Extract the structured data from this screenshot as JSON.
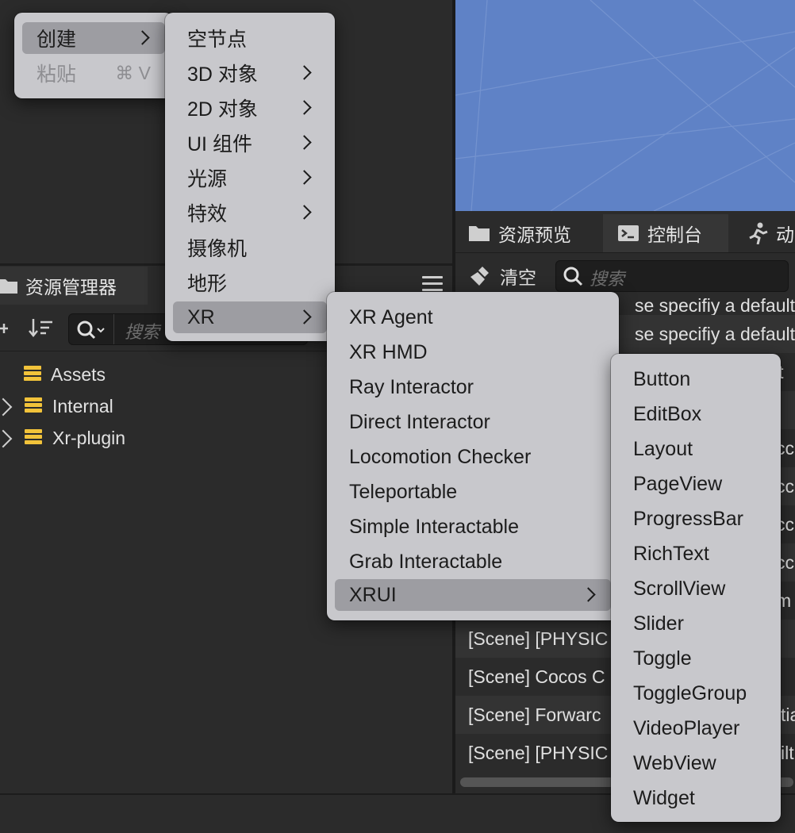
{
  "assets_panel": {
    "tab_label": "资源管理器",
    "search_placeholder": "搜索",
    "tree": [
      {
        "label": "Assets"
      },
      {
        "label": "Internal"
      },
      {
        "label": "Xr-plugin"
      }
    ]
  },
  "console_panel": {
    "tabs": [
      {
        "label": "资源预览"
      },
      {
        "label": "控制台"
      },
      {
        "label": "动"
      }
    ],
    "clear_label": "清空",
    "search_placeholder": "搜索",
    "logs": [
      "se specifiy a default",
      "se specifiy a default",
      "lt",
      "l",
      "cc",
      "cc",
      "cc",
      "cc",
      "m",
      "[Scene] [PHYSIC",
      "[Scene] Cocos C",
      "[Scene] Forwarc",
      "[Scene] [PHYSIC"
    ],
    "logs_right": [
      "",
      "",
      "",
      "",
      "",
      "",
      "",
      "",
      "",
      "",
      "",
      "tia",
      "ilt"
    ]
  },
  "context_menu": {
    "items": [
      {
        "label": "创建",
        "submenu": true,
        "highlighted": true
      },
      {
        "label": "粘贴",
        "shortcut": "⌘ V",
        "disabled": true
      }
    ]
  },
  "create_menu": {
    "items": [
      {
        "label": "空节点",
        "submenu": false
      },
      {
        "label": "3D 对象",
        "submenu": true
      },
      {
        "label": "2D 对象",
        "submenu": true
      },
      {
        "label": "UI 组件",
        "submenu": true
      },
      {
        "label": "光源",
        "submenu": true
      },
      {
        "label": "特效",
        "submenu": true
      },
      {
        "label": "摄像机",
        "submenu": false
      },
      {
        "label": "地形",
        "submenu": false
      },
      {
        "label": "XR",
        "submenu": true,
        "highlighted": true
      }
    ]
  },
  "xr_menu": {
    "items": [
      {
        "label": "XR Agent"
      },
      {
        "label": "XR HMD"
      },
      {
        "label": "Ray Interactor"
      },
      {
        "label": "Direct Interactor"
      },
      {
        "label": "Locomotion Checker"
      },
      {
        "label": "Teleportable"
      },
      {
        "label": "Simple Interactable"
      },
      {
        "label": "Grab Interactable"
      },
      {
        "label": "XRUI",
        "submenu": true,
        "highlighted": true
      }
    ]
  },
  "xrui_menu": {
    "items": [
      {
        "label": "Button"
      },
      {
        "label": "EditBox"
      },
      {
        "label": "Layout"
      },
      {
        "label": "PageView"
      },
      {
        "label": "ProgressBar"
      },
      {
        "label": "RichText"
      },
      {
        "label": "ScrollView"
      },
      {
        "label": "Slider"
      },
      {
        "label": "Toggle"
      },
      {
        "label": "ToggleGroup"
      },
      {
        "label": "VideoPlayer"
      },
      {
        "label": "WebView"
      },
      {
        "label": "Widget"
      }
    ]
  },
  "colors": {
    "scene_bg": "#5f82c6",
    "menu_bg": "#c8c8cc",
    "menu_highlight": "#9d9da2",
    "folder": "#f2c33a"
  }
}
